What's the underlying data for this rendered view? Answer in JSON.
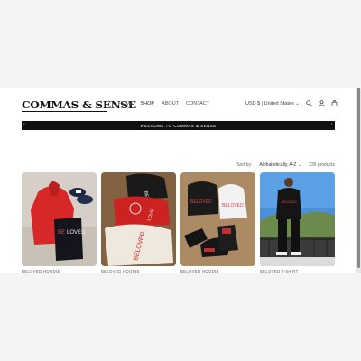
{
  "header": {
    "logo": "COMMAS & SENSE",
    "nav": [
      "HOME",
      "SHOP",
      "ABOUT",
      "CONTACT"
    ],
    "active_nav": "SHOP",
    "currency": "USD $ | United States",
    "icons": [
      "search-icon",
      "account-icon",
      "cart-icon"
    ]
  },
  "announcement": {
    "text": "WELCOME TO COMMAS & SENSE",
    "prev_icon": "‹",
    "next_icon": "›"
  },
  "toolbar": {
    "sort_label": "Sort by:",
    "sort_value": "Alphabetically, A-Z",
    "product_count": "236 products"
  },
  "products": [
    {
      "title": "BELOVED HOODIE"
    },
    {
      "title": "BELOVED HOODIE"
    },
    {
      "title": "BELOVED HOODIE"
    },
    {
      "title": "BELOVED T-SHIRT"
    }
  ],
  "colors": {
    "announcement_bg": "#111111",
    "page_bg": "#f4f4f4",
    "accent_red": "#d62828"
  }
}
